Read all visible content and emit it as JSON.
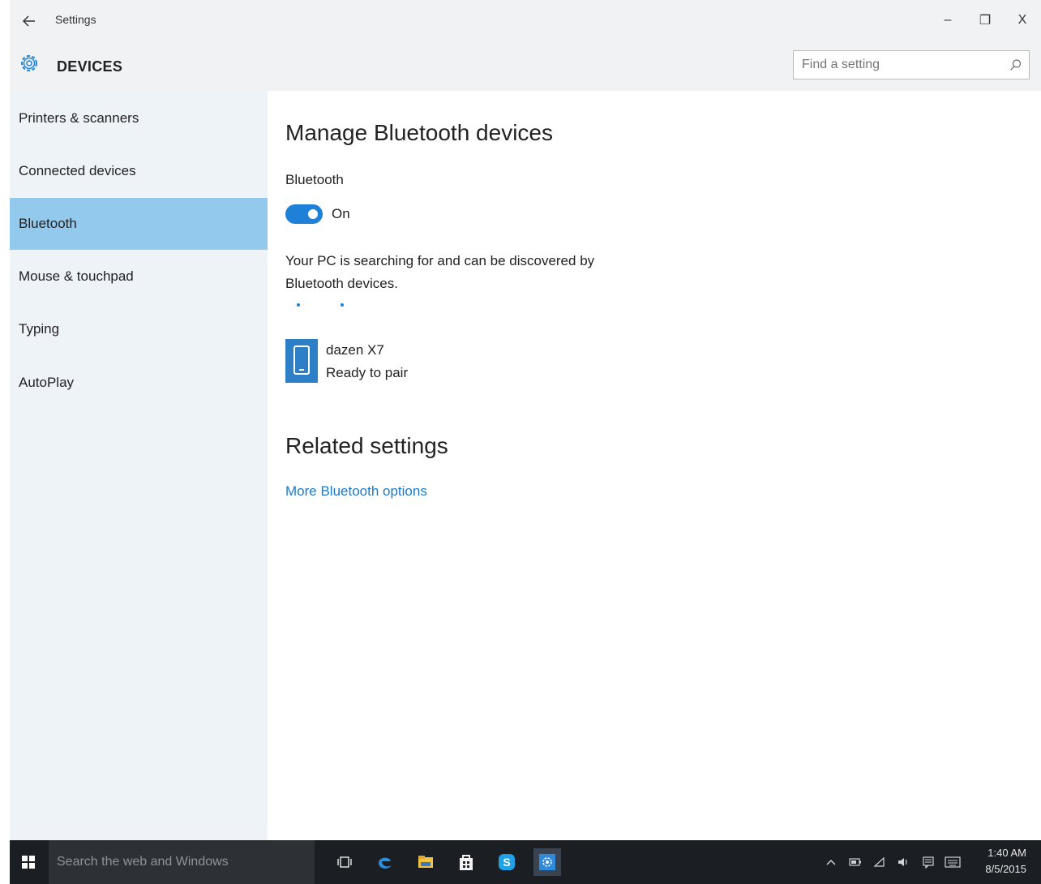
{
  "window": {
    "title": "Settings",
    "back_icon": "back-arrow-icon",
    "minimize_label": "–",
    "maximize_label": "❐",
    "close_label": "X"
  },
  "header": {
    "icon": "gear-icon",
    "title": "DEVICES",
    "search_placeholder": "Find a setting"
  },
  "sidebar": {
    "items": [
      {
        "label": "Printers & scanners",
        "active": false
      },
      {
        "label": "Connected devices",
        "active": false
      },
      {
        "label": "Bluetooth",
        "active": true
      },
      {
        "label": "Mouse & touchpad",
        "active": false
      },
      {
        "label": "Typing",
        "active": false
      },
      {
        "label": "AutoPlay",
        "active": false
      }
    ]
  },
  "main": {
    "heading": "Manage Bluetooth devices",
    "bluetooth_label": "Bluetooth",
    "toggle_state": "On",
    "description": "Your PC is searching for and can be discovered by Bluetooth devices.",
    "device": {
      "icon": "phone-icon",
      "name": "dazen X7",
      "status": "Ready to pair"
    },
    "related_heading": "Related settings",
    "related_link": "More Bluetooth options"
  },
  "taskbar": {
    "search_placeholder": "Search the web and Windows",
    "time": "1:40 AM",
    "date": "8/5/2015"
  },
  "colors": {
    "accent": "#1e80d6",
    "sidebar_bg": "#eef3f8",
    "selected_item": "#93c9ec",
    "link": "#1a7ac8",
    "taskbar": "#1b1e22"
  }
}
